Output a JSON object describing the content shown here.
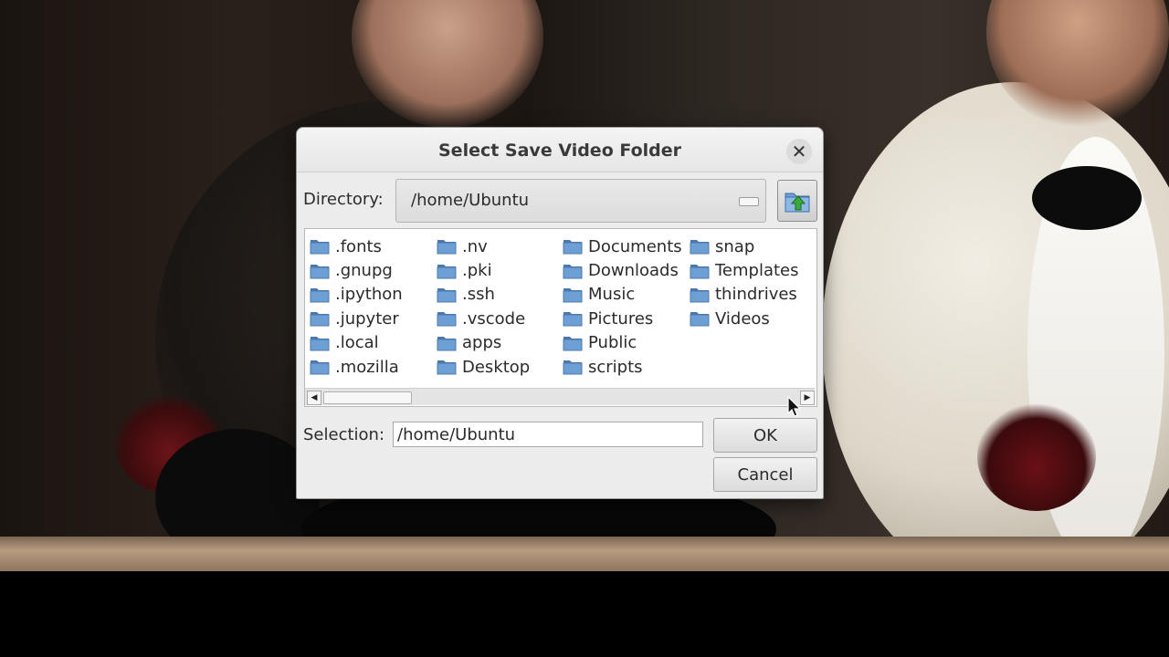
{
  "dialog": {
    "title": "Select Save Video Folder",
    "close_glyph": "✕",
    "directory_label": "Directory:",
    "directory_value": "/home/Ubuntu",
    "up_button_icon": "folder-up-icon",
    "selection_label": "Selection:",
    "selection_value": "/home/Ubuntu",
    "ok_label": "OK",
    "cancel_label": "Cancel"
  },
  "files": {
    "columns": [
      [
        ".fonts",
        ".gnupg",
        ".ipython",
        ".jupyter",
        ".local",
        ".mozilla"
      ],
      [
        ".nv",
        ".pki",
        ".ssh",
        ".vscode",
        "apps",
        "Desktop"
      ],
      [
        "Documents",
        "Downloads",
        "Music",
        "Pictures",
        "Public",
        "scripts"
      ],
      [
        "snap",
        "Templates",
        "thindrives",
        "Videos"
      ]
    ],
    "item_icon": "folder-icon"
  },
  "scrollbar": {
    "left_arrow": "◀",
    "right_arrow": "▶"
  },
  "colors": {
    "folder_fill": "#6e9fd4",
    "folder_dark": "#4a78ad",
    "up_arrow": "#3aa83a"
  }
}
